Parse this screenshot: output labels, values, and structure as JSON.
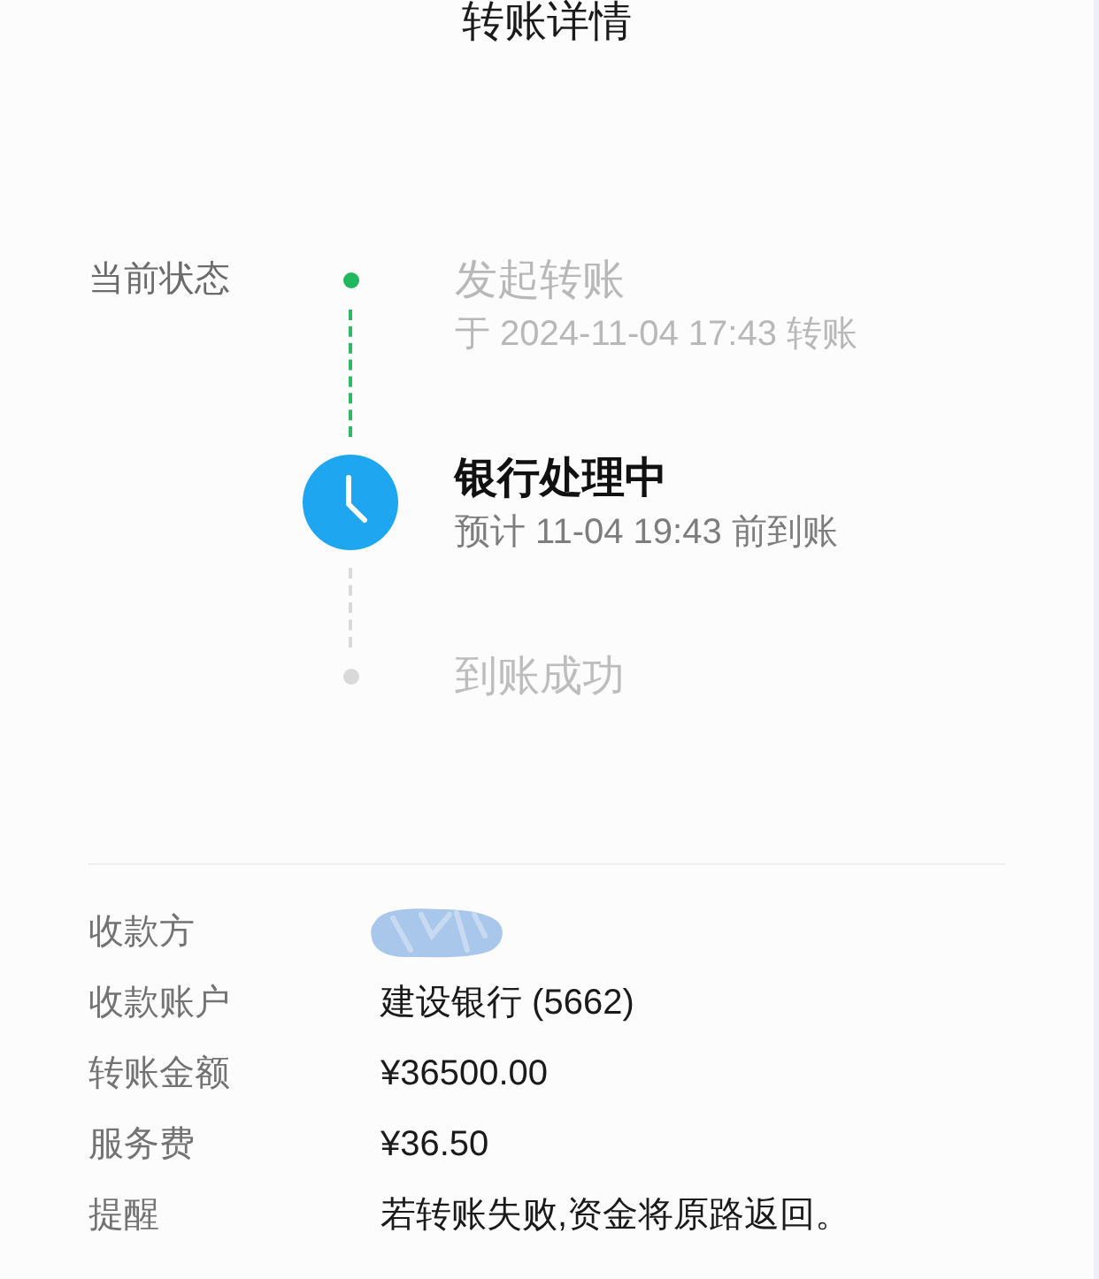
{
  "title": "转账详情",
  "status": {
    "label": "当前状态",
    "steps": [
      {
        "title": "发起转账",
        "subtitle": "于 2024-11-04 17:43 转账",
        "done": true,
        "current": false
      },
      {
        "title": "银行处理中",
        "subtitle": "预计 11-04 19:43 前到账",
        "done": false,
        "current": true
      },
      {
        "title": "到账成功",
        "done": false,
        "current": false
      }
    ]
  },
  "details": [
    {
      "label": "收款方",
      "kind": "redacted"
    },
    {
      "label": "收款账户",
      "kind": "text",
      "value": "建设银行 (5662)"
    },
    {
      "label": "转账金额",
      "kind": "text",
      "value": "¥36500.00"
    },
    {
      "label": "服务费",
      "kind": "text",
      "value": "¥36.50"
    },
    {
      "label": "提醒",
      "kind": "text",
      "value": "若转账失败,资金将原路返回。"
    }
  ]
}
